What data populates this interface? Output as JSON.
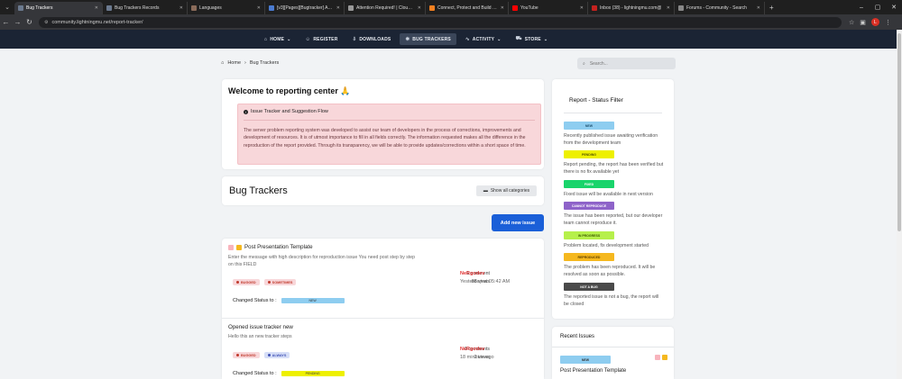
{
  "browser": {
    "tabs": [
      {
        "title": "Bug Trackers",
        "favicon_color": "#6b7a8f",
        "active": true
      },
      {
        "title": "Bug Trackers Records",
        "favicon_color": "#6b7a8f"
      },
      {
        "title": "Languages",
        "favicon_color": "#8a6b5a"
      },
      {
        "title": "[v3][Pages][Bugtracker] Advan",
        "favicon_color": "#4a7bd0"
      },
      {
        "title": "Attention Required! | Cloudflare",
        "favicon_color": "#999999"
      },
      {
        "title": "Connect, Protect and Build Ever",
        "favicon_color": "#f38020"
      },
      {
        "title": "YouTube",
        "favicon_color": "#ff0000"
      },
      {
        "title": "Inbox (38) - lightningmu.com@",
        "favicon_color": "#c5221f"
      },
      {
        "title": "Forums - Community - Search",
        "favicon_color": "#888888"
      }
    ],
    "url": "community.lightningmu.net/report-tracker/",
    "profile_initial": "L"
  },
  "site_nav": {
    "items": [
      {
        "label": "HOME",
        "icon": "home-icon",
        "has_caret": true
      },
      {
        "label": "REGISTER",
        "icon": "user-icon",
        "has_caret": false
      },
      {
        "label": "DOWNLOADS",
        "icon": "download-icon",
        "has_caret": false
      },
      {
        "label": "BUG TRACKERS",
        "icon": "bug-icon",
        "has_caret": false,
        "active": true
      },
      {
        "label": "ACTIVITY",
        "icon": "activity-icon",
        "has_caret": true
      },
      {
        "label": "STORE",
        "icon": "cart-icon",
        "has_caret": true
      }
    ]
  },
  "breadcrumb": {
    "home": "Home",
    "current": "Bug Trackers"
  },
  "search": {
    "placeholder": "Search..."
  },
  "welcome": {
    "title": "Welcome to reporting center 🙏",
    "alert_title": "Issue Tracker and Suggestion Flow",
    "alert_body": "The server problem reporting system was developed to assist our team of developers in the process of corrections, improvements and development of resources. It is of utmost importance to fill in all fields correctly. The information requested makes all the difference in the reproduction of the report provided. Through its transparency, we will be able to provide updates/corrections within a short space of time."
  },
  "trackers": {
    "title": "Bug Trackers",
    "show_all": "Show all categories",
    "add_new": "Add new issue"
  },
  "issues": [
    {
      "title": "Post Presentation Template",
      "description": "Enter the message with high description for reproduction issue    You need post step by step on this FIELD",
      "comments": "1 comment",
      "views": "88 views",
      "author": "NeRgodev",
      "when": "Yesterday at 05:42 AM",
      "tags": [
        {
          "label": "BUGGED",
          "bg": "#f8d7da",
          "fg": "#c0392b"
        },
        {
          "label": "SOMETIMES",
          "bg": "#f8d7da",
          "fg": "#c0392b"
        }
      ],
      "changed_label": "Changed Status to :",
      "changed_value": "NEW",
      "changed_color": "#8ecdf0"
    },
    {
      "title": "Opened issue tracker new",
      "description": "Hello this an new tracker steps",
      "comments": "0 comments",
      "views": "2 views",
      "author": "NeRgodev",
      "when": "18 minutes ago",
      "tags": [
        {
          "label": "BUGGED",
          "bg": "#f8d7da",
          "fg": "#c0392b"
        },
        {
          "label": "ALWAYS",
          "bg": "#d6def7",
          "fg": "#3f51b5"
        }
      ],
      "changed_label": "Changed Status to :",
      "changed_value": "PENDING",
      "changed_color": "#eef000"
    }
  ],
  "status_filter": {
    "title": "Report - Status Filter",
    "items": [
      {
        "label": "NEW",
        "color": "#8ecdf0",
        "text_color": "#1d4e6b",
        "description": "Recently published issue awaiting verification from the development team"
      },
      {
        "label": "PENDING",
        "color": "#eef000",
        "text_color": "#555500",
        "description": "Report pending, the report has been verified but there is no fix available yet"
      },
      {
        "label": "FIXED",
        "color": "#19d46b",
        "text_color": "#ffffff",
        "description": "Fixed issue will be available in next version"
      },
      {
        "label": "CANNOT REPRODUCE",
        "color": "#8e63c9",
        "text_color": "#ffffff",
        "description": "The issue has been reported, but our developer team cannot reproduce it."
      },
      {
        "label": "IN PROGRESS",
        "color": "#b6f04b",
        "text_color": "#3d5a00",
        "description": "Problem located, fix development started"
      },
      {
        "label": "REPRODUCED",
        "color": "#f5b81f",
        "text_color": "#5a3d00",
        "description": "The problem has been reproduced. It will be resolved as soon as possible."
      },
      {
        "label": "NOT A BUG",
        "color": "#4a4a4a",
        "text_color": "#ffffff",
        "description": "The reported issue is not a bug, the report will be closed"
      }
    ]
  },
  "recent": {
    "title": "Recent Issues",
    "badge": "NEW",
    "badge_color": "#8ecdf0",
    "item_title": "Post Presentation Template"
  }
}
